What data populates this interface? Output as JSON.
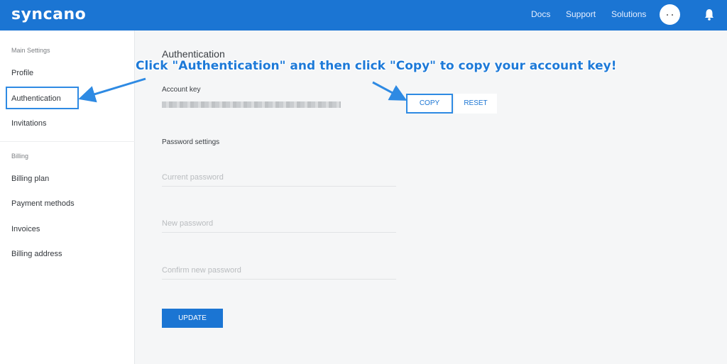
{
  "header": {
    "logo": "syncano",
    "nav": [
      "Docs",
      "Support",
      "Solutions"
    ],
    "icons": [
      "avatar",
      "bell-icon"
    ]
  },
  "sidebar": {
    "main_heading": "Main Settings",
    "main_items": [
      {
        "label": "Profile"
      },
      {
        "label": "Authentication"
      },
      {
        "label": "Invitations"
      }
    ],
    "billing_heading": "Billing",
    "billing_items": [
      {
        "label": "Billing plan"
      },
      {
        "label": "Payment methods"
      },
      {
        "label": "Invoices"
      },
      {
        "label": "Billing address"
      }
    ]
  },
  "main": {
    "title": "Authentication",
    "annotation": "Click \"Authentication\" and then click \"Copy\" to copy your account key!",
    "account_key_label": "Account key",
    "copy_label": "COPY",
    "reset_label": "RESET",
    "password_heading": "Password settings",
    "fields": {
      "current": "Current password",
      "new": "New password",
      "confirm": "Confirm new password"
    },
    "update_label": "UPDATE"
  },
  "colors": {
    "brand": "#1b75d3",
    "annotation": "#1e7ad8"
  }
}
